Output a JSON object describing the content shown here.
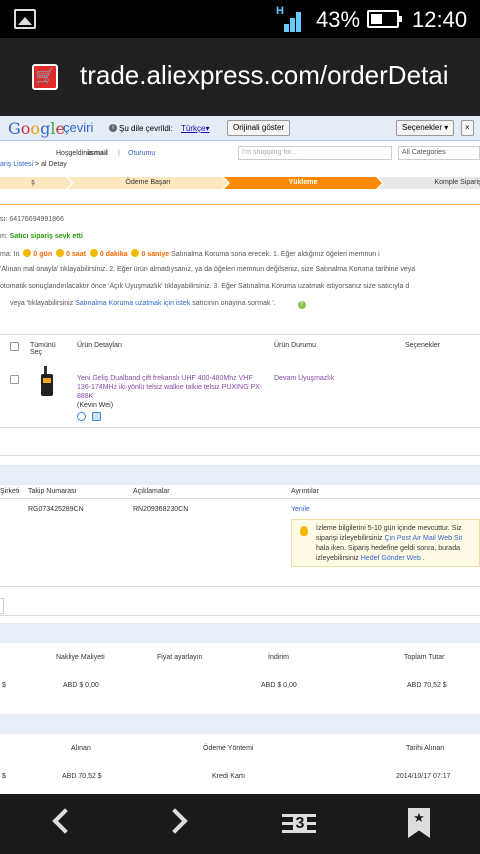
{
  "status_bar": {
    "network": "H",
    "battery_pct": "43%",
    "time": "12:40"
  },
  "browser": {
    "url": "trade.aliexpress.com/orderDetai"
  },
  "translate_bar": {
    "logo": "Google",
    "logo_suffix": "çeviri",
    "translated_to": "Şu dile çevrildi:",
    "language": "Türkçe▾",
    "show_original": "Orijinali göster",
    "options": "Seçenekler ▾",
    "close": "×"
  },
  "header": {
    "hello": "Hoşgeldiniz",
    "username": "ismail",
    "divider": "|",
    "sign_in": "Oturumu",
    "search_placeholder": "I'm shopping for...",
    "category": "All Categories"
  },
  "breadcrumb": {
    "link": "ariş Listesi",
    "separator": " > ",
    "current": "al Detay"
  },
  "steps": [
    {
      "label": "ş"
    },
    {
      "label": "Ödeme Başarı"
    },
    {
      "label": "Yükleme"
    },
    {
      "label": "Komple Sipariş"
    }
  ],
  "order": {
    "number_label": "sı:",
    "number": "64176694991866",
    "status_label": "m:",
    "status": "Satıcı sipariş sevk etti",
    "line3_prefix": "ma: In",
    "t0": "0",
    "u0": "gün",
    "t1": "0",
    "u1": "saat",
    "t2": "0",
    "u2": "dakika",
    "t3": "0",
    "u3": "saniye",
    "line3_suffix": "Satınalma Koruma sona erecek. 1. Eğer aldığınız öğeleri memnun i",
    "line4": "'Alınan mal onayla' tıklayabilirsiniz. 2. Eğer ürün almadıysanız, ya da öğeleri memnun değilseniz, size Satınalma Koruma tarihine veya",
    "line5": "otomatik sonuçlandırılacaktır önce 'Açık Uyuşmazlık' tıklayabilirsiniz. 3.  Eğer Satınalma Koruma uzatmak istiyorsanız size satıcıyla d",
    "line6_prefix": "veya 'tıklayabilirsiniz",
    "line6_link": "Satınalma Koruma uzatmak için istek",
    "line6_suffix": "satıcının onayına sormak '.",
    "help": "?"
  },
  "products": {
    "headers": {
      "select_all": "Tümünü Seç",
      "details": "Ürün Detayları",
      "status": "Ürün Durumu",
      "options": "Seçenekler"
    },
    "items": [
      {
        "title": "Yeni Geliş Dualband çift frekanslı UHF 400-480Mhz VHF 136-174MHz iki yönlü telsiz walkie talkie telsiz PUXING PX-888K",
        "seller": "(Kevin Wei)",
        "status": "Devam Uyuşmazlık"
      }
    ]
  },
  "shipping": {
    "headers": {
      "company": "Şirketi",
      "tracking": "Takip Numarası",
      "notes": "Açıklamalar",
      "details": "Ayrıntılar"
    },
    "rows": [
      {
        "tracking": "RG073425289CN",
        "notes": "RN209368230CN",
        "action": "Yenile"
      }
    ],
    "info_line1": "İzleme bilgilerini 5-10 gün içinde mevcuttur. Siz",
    "info_line2_prefix": "siparişi izleyebilirsiniz",
    "info_line2_link": "Çin Post Air Mail Web Sit",
    "info_line3": "hala iken. Sipariş hedefine geldi sonra, burada",
    "info_line4_prefix": "izleyebilirsiniz",
    "info_line4_link": "Hedef Gönder Web",
    "info_line4_suffix": "."
  },
  "payment": {
    "headers": {
      "shipping_cost": "Nakliye Maliyeti",
      "price_adjust": "Fiyat ayarlayın",
      "discount": "İndirim",
      "total": "Toplam Tutar"
    },
    "row": {
      "first": "$",
      "shipping_cost": "ABD $ 0,00",
      "discount": "ABD $ 0,00",
      "total": "ABD 70,52 $"
    }
  },
  "summary": {
    "headers": {
      "received": "Alınan",
      "method": "Ödeme Yöntemi",
      "date": "Tarihi Alınan"
    },
    "row": {
      "first": "$",
      "received": "ABD 70,52 $",
      "method": "Kredi Kartı",
      "date": "2014/10/17 07:17"
    }
  },
  "nav": {
    "tabs_count": "3",
    "bookmark": "★"
  }
}
